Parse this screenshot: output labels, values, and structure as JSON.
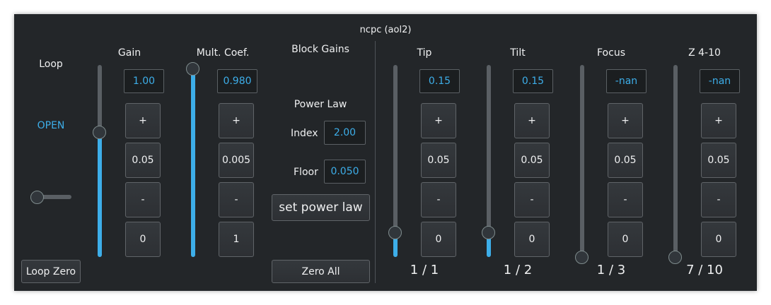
{
  "window": {
    "title": "ncpc (aol2)"
  },
  "loop": {
    "label": "Loop",
    "status": "OPEN",
    "zero_button": "Loop Zero",
    "slider_value": 0
  },
  "gain": {
    "label": "Gain",
    "value": "1.00",
    "plus": "+",
    "step": "0.05",
    "minus": "-",
    "reset": "0",
    "slider_fraction": 0.65
  },
  "mult": {
    "label": "Mult. Coef.",
    "value": "0.980",
    "plus": "+",
    "step": "0.005",
    "minus": "-",
    "reset": "1",
    "slider_fraction": 0.98
  },
  "block": {
    "title": "Block Gains",
    "power_law": "Power Law",
    "index_label": "Index",
    "index_value": "2.00",
    "floor_label": "Floor",
    "floor_value": "0.050",
    "set_button": "set power law",
    "zero_all": "Zero All"
  },
  "blocks": [
    {
      "label": "Tip",
      "value": "0.15",
      "plus": "+",
      "step": "0.05",
      "minus": "-",
      "reset": "0",
      "frac": "1 / 1",
      "slider_fraction": 0.13
    },
    {
      "label": "Tilt",
      "value": "0.15",
      "plus": "+",
      "step": "0.05",
      "minus": "-",
      "reset": "0",
      "frac": "1 / 2",
      "slider_fraction": 0.13
    },
    {
      "label": "Focus",
      "value": "-nan",
      "plus": "+",
      "step": "0.05",
      "minus": "-",
      "reset": "0",
      "frac": "1 / 3",
      "slider_fraction": 0.0
    },
    {
      "label": "Z 4-10",
      "value": "-nan",
      "plus": "+",
      "step": "0.05",
      "minus": "-",
      "reset": "0",
      "frac": "7 / 10",
      "slider_fraction": 0.0
    }
  ],
  "colors": {
    "accent": "#3daee9",
    "background": "#232629",
    "text": "#eff0f1"
  }
}
